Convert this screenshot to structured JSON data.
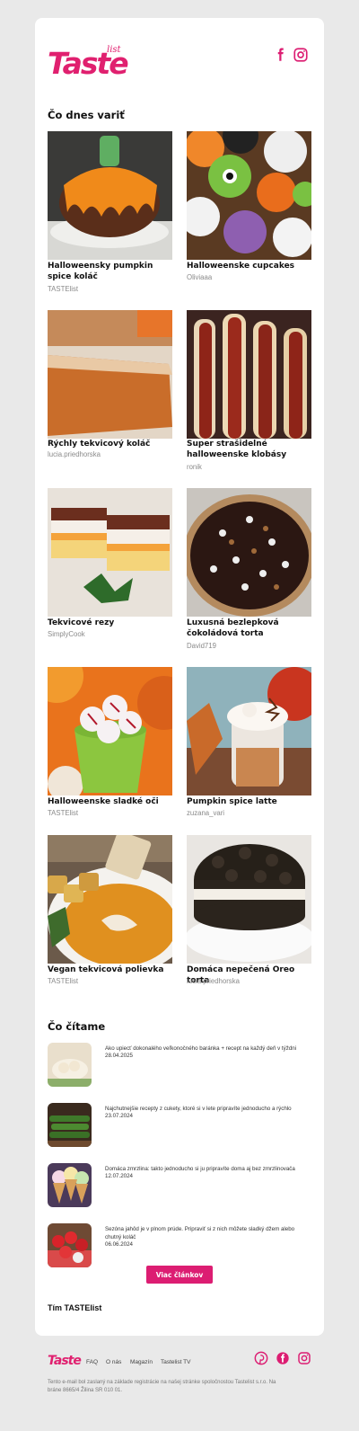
{
  "header": {
    "logo_text": "Taste",
    "logo_sup": "list",
    "social": [
      "facebook-icon",
      "instagram-icon"
    ]
  },
  "colors": {
    "brand": "#dc1d72",
    "background": "#e9e9e9"
  },
  "recipes_section": {
    "title": "Čo dnes variť",
    "items": [
      {
        "title": "Halloweensky pumpkin spice koláč",
        "author": "TASTElist"
      },
      {
        "title": "Halloweenske cupcakes",
        "author": "Oliviaaa"
      },
      {
        "title": "Rýchly tekvicový koláč",
        "author": "lucia.priedhorska"
      },
      {
        "title": "Super strašidelné halloweenske klobásy",
        "author": "ronik"
      },
      {
        "title": "Tekvicové rezy",
        "author": "SimplyCook"
      },
      {
        "title": "Luxusná bezlepková čokoládová torta",
        "author": "David719"
      },
      {
        "title": "Halloweenske sladké oči",
        "author": "TASTElist"
      },
      {
        "title": "Pumpkin spice latte",
        "author": "zuzana_vari"
      },
      {
        "title": "Vegan tekvicová polievka",
        "author": "TASTElist"
      },
      {
        "title": "Domáca nepečená Oreo torta",
        "author": "lucia.priedhorska"
      }
    ]
  },
  "articles_section": {
    "title": "Čo čítame",
    "items": [
      {
        "title": "Ako upiecť dokonalého veľkonočného baránka + recept na každý deň v týždni",
        "date": "28.04.2025"
      },
      {
        "title": "Najchutnejšie recepty z cukety, ktoré si v lete pripravíte jednoducho a rýchlo",
        "date": "23.07.2024"
      },
      {
        "title": "Domáca zmrzlina: takto jednoducho si ju pripravíte doma aj bez zmrzlinovača",
        "date": "12.07.2024"
      },
      {
        "title": "Sezóna jahôd je v plnom prúde. Pripraviť si z nich môžete sladký džem alebo chutný koláč",
        "date": "06.06.2024"
      }
    ],
    "more_button": "Viac článkov"
  },
  "signature": "Tím TASTElist",
  "footer": {
    "logo_text": "Taste",
    "links": [
      "FAQ",
      "O nás",
      "Magazín",
      "Tastelist TV"
    ],
    "social": [
      "pinterest-icon",
      "facebook-icon",
      "instagram-icon"
    ],
    "note": "Tento e-mail bol zaslaný na základe registrácie na našej stránke spoločnostou Tastelist s.r.o. Na bráne 8665/4 Žilina SR 010 01."
  }
}
